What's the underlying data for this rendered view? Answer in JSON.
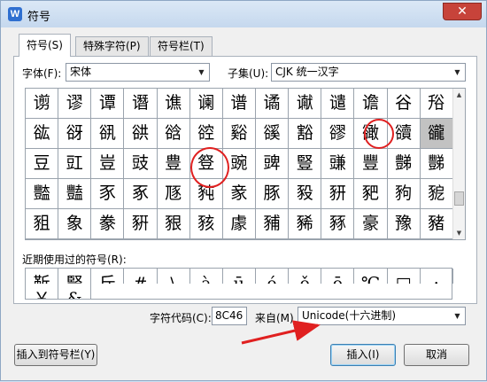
{
  "window": {
    "title": "符号",
    "close_label": "✕"
  },
  "tabs": [
    {
      "label": "符号(S)",
      "active": true
    },
    {
      "label": "特殊字符(P)",
      "active": false
    },
    {
      "label": "符号栏(T)",
      "active": false
    }
  ],
  "font": {
    "label": "字体(F):",
    "value": "宋体"
  },
  "subset": {
    "label": "子集(U):",
    "value": "CJK 统一汉字"
  },
  "symbol_grid": {
    "selected": {
      "row": 1,
      "col": 11
    },
    "rows": [
      [
        "谫",
        "谬",
        "谭",
        "谮",
        "谯",
        "谰",
        "谱",
        "谲",
        "谳",
        "谴",
        "谵",
        "谷",
        "谸",
        "谹"
      ],
      [
        "谺",
        "谻",
        "谼",
        "谽",
        "谾",
        "谿",
        "豀",
        "豁",
        "豂",
        "豃",
        "豄",
        "豅",
        "豆",
        "豇",
        "豈"
      ],
      [
        "豉",
        "豊",
        "豋",
        "豌",
        "豍",
        "豎",
        "豏",
        "豐",
        "豑",
        "豒",
        "豓",
        "豔",
        "豕",
        "豖",
        "豗"
      ],
      [
        "豘",
        "豙",
        "豚",
        "豛",
        "豜",
        "豝",
        "豞",
        "豟",
        "豠",
        "象",
        "豢",
        "豣",
        "豤",
        "豥",
        "豦"
      ],
      [
        "豧",
        "豨",
        "豩",
        "豪",
        "豫",
        "豬",
        "豭",
        "豮",
        "豯",
        "豰",
        "豱",
        "豲",
        "豳",
        "豴",
        "豵"
      ]
    ]
  },
  "recent": {
    "label": "近期使用过的符号(R):",
    "symbols": [
      "靳",
      "豎",
      "斤",
      "#",
      "\\",
      "à",
      "ū",
      "é",
      "ǒ",
      "ō",
      "℃",
      "□",
      ":",
      "￥",
      "&"
    ]
  },
  "char_code": {
    "label": "字符代码(C):",
    "value": "8C46"
  },
  "from": {
    "label": "来自(M)",
    "value": "Unicode(十六进制)"
  },
  "buttons": {
    "insert_to_bar": "插入到符号栏(Y)",
    "insert": "插入(I)",
    "cancel": "取消"
  },
  "annotation_color": "#e02020"
}
